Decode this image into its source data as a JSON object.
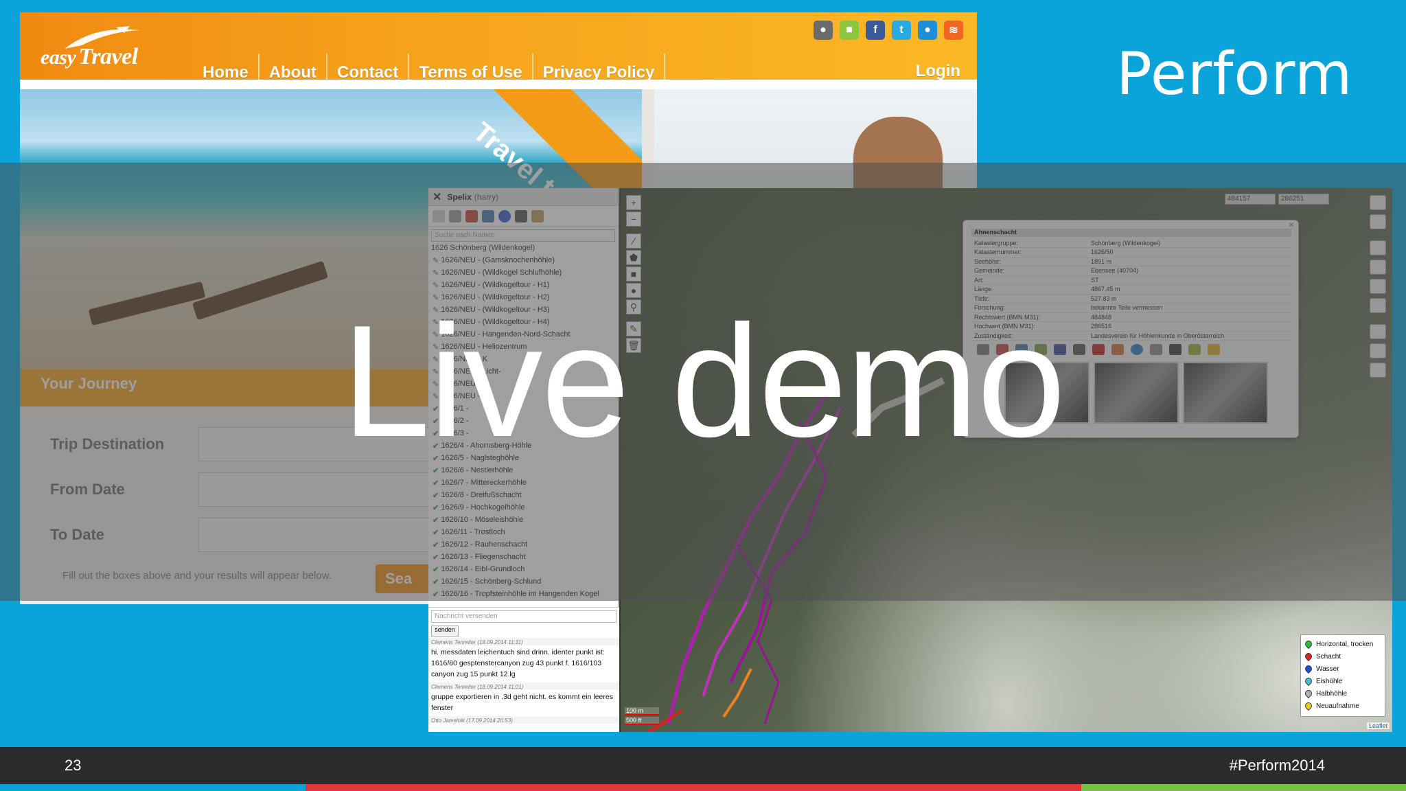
{
  "slide": {
    "headline": "Live demo",
    "brand": "Perform",
    "slide_number": "23",
    "hashtag": "#Perform2014",
    "colors": {
      "background": "#0aa3da",
      "footer": "#2b2b2d",
      "stripe": [
        "#0aa3da",
        "#e3343a",
        "#7ac143"
      ]
    }
  },
  "site": {
    "logo": "easyTravel",
    "logo_easy": "easy",
    "logo_travel": "Travel",
    "nav": [
      "Home",
      "About",
      "Contact",
      "Terms of Use",
      "Privacy Policy"
    ],
    "login": "Login",
    "social_icons": [
      "apple-icon",
      "android-icon",
      "facebook-icon",
      "twitter-icon",
      "blackberry-icon",
      "rss-icon"
    ],
    "banner_ribbon": "Travel to P",
    "journey": {
      "title": "Your Journey",
      "fields": [
        "Trip Destination",
        "From Date",
        "To Date"
      ],
      "hint": "Fill out the boxes above and your results will appear below.",
      "search_button": "Sea"
    },
    "colors": {
      "header_start": "#f08a12",
      "header_end": "#fbb826"
    }
  },
  "spelix": {
    "title": "Spelix",
    "user": "(harry)",
    "search_placeholder": "Suche nach Namen",
    "group": "1626 Schönberg (Wildenkogel)",
    "caves": [
      {
        "name": "1626/NEU - (Gamsknochenhöhle)",
        "status": "edit"
      },
      {
        "name": "1626/NEU - (Wildkogel Schlufhöhle)",
        "status": "edit"
      },
      {
        "name": "1626/NEU - (Wildkogeltour - H1)",
        "status": "edit"
      },
      {
        "name": "1626/NEU - (Wildkogeltour - H2)",
        "status": "edit"
      },
      {
        "name": "1626/NEU - (Wildkogeltour - H3)",
        "status": "edit"
      },
      {
        "name": "1626/NEU - (Wildkogeltour - H4)",
        "status": "edit"
      },
      {
        "name": "1626/NEU - Hangenden-Nord-Schacht",
        "status": "edit"
      },
      {
        "name": "1626/NEU - Heliozentrum",
        "status": "edit"
      },
      {
        "name": "1626/NEU - K",
        "status": "edit"
      },
      {
        "name": "1626/NEU - Licht-",
        "status": "edit"
      },
      {
        "name": "1626/NEU - ",
        "status": "edit"
      },
      {
        "name": "1626/NEU - ",
        "status": "edit"
      },
      {
        "name": "1626/1 - ",
        "status": "check"
      },
      {
        "name": "1626/2 - ",
        "status": "check"
      },
      {
        "name": "1626/3 - ",
        "status": "check"
      },
      {
        "name": "1626/4 - Ahornsberg-Höhle",
        "status": "check"
      },
      {
        "name": "1626/5 - Naglsteghöhle",
        "status": "check"
      },
      {
        "name": "1626/6 - Nestlerhöhle",
        "status": "check"
      },
      {
        "name": "1626/7 - Mittereckerhöhle",
        "status": "check"
      },
      {
        "name": "1626/8 - Dreifußschacht",
        "status": "check"
      },
      {
        "name": "1626/9 - Hochkogelhöhle",
        "status": "check"
      },
      {
        "name": "1626/10 - Möseleishöhle",
        "status": "check"
      },
      {
        "name": "1626/11 - Trostloch",
        "status": "check"
      },
      {
        "name": "1626/12 - Rauhenschacht",
        "status": "check"
      },
      {
        "name": "1626/13 - Fliegenschacht",
        "status": "check"
      },
      {
        "name": "1626/14 - Eibl-Grundloch",
        "status": "check"
      },
      {
        "name": "1626/15 - Schönberg-Schlund",
        "status": "check"
      },
      {
        "name": "1626/16 - Tropfsteinhöhle im Hangenden Kogel",
        "status": "check"
      }
    ],
    "chat": {
      "input_placeholder": "Nachricht versenden",
      "send_button": "senden",
      "messages": [
        {
          "meta": "Clemens Tenreiter (18.09.2014 11:11)",
          "text": "hi. messdaten leichentuch sind drinn. identer punkt ist: 1616/80 gesptenstercanyon zug 43 punkt f. 1616/103 canyon zug 15 punkt 12.lg"
        },
        {
          "meta": "Clemens Tenreiter (18.09.2014 11:01)",
          "text": "gruppe exportieren in .3d geht nicht. es kommt ein leeres fenster"
        },
        {
          "meta": "Otto Jamelnik (17.09.2014 20:53)",
          "text": ""
        }
      ]
    }
  },
  "map": {
    "coords": [
      "484157",
      "286251"
    ],
    "zoom_in": "+",
    "zoom_out": "−",
    "info": {
      "title": "Ahnenschacht",
      "rows": [
        [
          "Katastergruppe:",
          "Schönberg (Wildenkogel)"
        ],
        [
          "Katasternummer:",
          "1626/50"
        ],
        [
          "Seehöhe:",
          "1891 m"
        ],
        [
          "Gemeinde:",
          "Ebensee (40704)"
        ],
        [
          "Art:",
          "ST"
        ],
        [
          "Länge:",
          "4867.45 m"
        ],
        [
          "Tiefe:",
          "527.83 m"
        ],
        [
          "Forschung:",
          "bekannte Teile vermessen"
        ],
        [
          "Rechtswert (BMN M31):",
          "484848"
        ],
        [
          "Hochwert (BMN M31):",
          "286516"
        ],
        [
          "Zuständigkeit:",
          "Landesverein für Höhlenkunde in Oberösterreich"
        ]
      ]
    },
    "legend": [
      {
        "label": "Horizontal, trocken",
        "color": "#2fbf2f"
      },
      {
        "label": "Schacht",
        "color": "#e02020"
      },
      {
        "label": "Wasser",
        "color": "#2050d0"
      },
      {
        "label": "Eishöhle",
        "color": "#40c0d0"
      },
      {
        "label": "Halbhöhle",
        "color": "#b0b0b0"
      },
      {
        "label": "Neuaufnahme",
        "color": "#e8d020"
      }
    ],
    "scale": [
      "100 m",
      "500 ft"
    ],
    "attribution": "Leaflet"
  }
}
